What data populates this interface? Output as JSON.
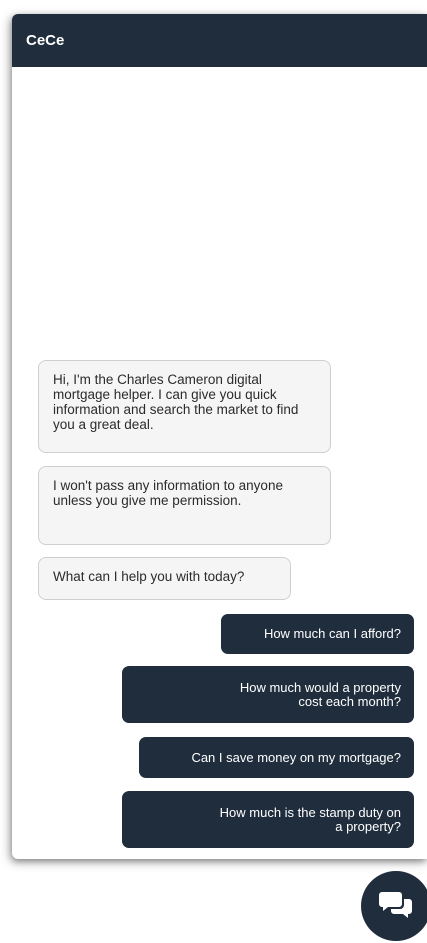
{
  "header": {
    "title": "CeCe"
  },
  "bot_messages": [
    "Hi, I'm the Charles Cameron digital mortgage helper. I can give you quick information and search the market to find you a great deal.",
    "I won't pass any information to anyone unless you give me permission.",
    "What can I help you with today?"
  ],
  "options": [
    "How much can I afford?",
    "How much would a property cost each month?",
    "Can I save money on my mortgage?",
    "How much is the stamp duty on a property?"
  ],
  "launcher": {
    "icon": "chat-bubbles-icon"
  },
  "colors": {
    "primary": "#1f2d3d",
    "bot_bubble": "#f5f5f5",
    "bot_border": "#cfcfcf"
  }
}
